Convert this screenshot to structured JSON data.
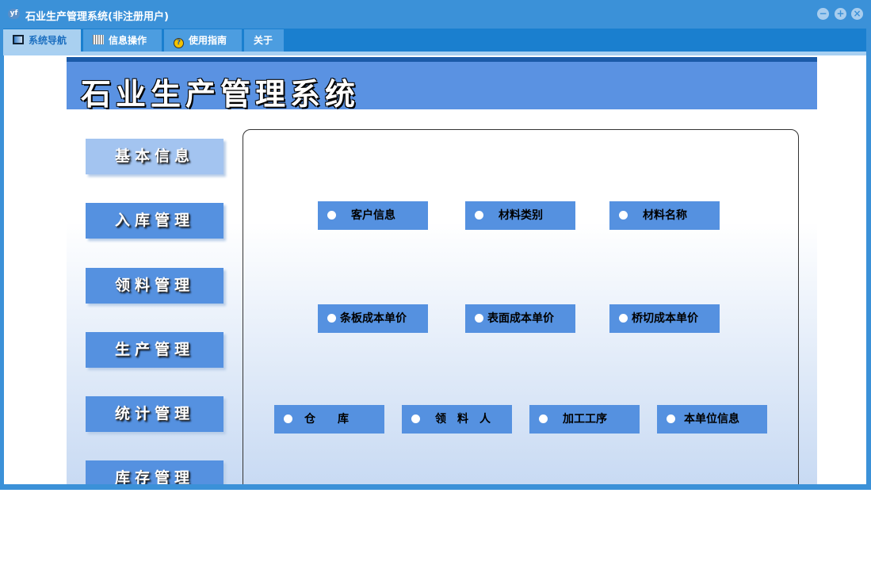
{
  "window": {
    "title": "石业生产管理系统(非注册用户)",
    "logo": "YF",
    "controls": [
      "minimize",
      "restore",
      "close"
    ]
  },
  "tabs": [
    {
      "label": "系统导航",
      "icon": "monitor-icon"
    },
    {
      "label": "信息操作",
      "icon": "grid-icon"
    },
    {
      "label": "使用指南",
      "icon": "help-icon"
    },
    {
      "label": "关于"
    }
  ],
  "banner": {
    "title": "石业生产管理系统"
  },
  "nav": [
    "基本信息",
    "入库管理",
    "领料管理",
    "生产管理",
    "统计管理",
    "库存管理"
  ],
  "items": {
    "row1": [
      "客户信息",
      "材料类别",
      "材料名称"
    ],
    "row2": [
      "条板成本单价",
      "表面成本单价",
      "桥切成本单价"
    ],
    "row3": [
      "仓　　库",
      "领　料　人",
      "加工工序",
      "本单位信息"
    ]
  }
}
